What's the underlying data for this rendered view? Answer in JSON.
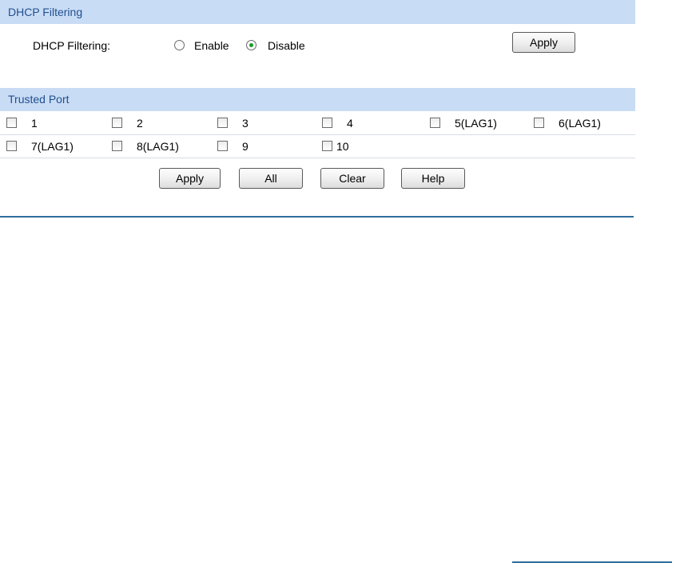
{
  "dhcp_filtering": {
    "section_title": "DHCP Filtering",
    "field_label": "DHCP Filtering:",
    "options": [
      {
        "label": "Enable",
        "selected": false
      },
      {
        "label": "Disable",
        "selected": true
      }
    ],
    "apply_label": "Apply"
  },
  "trusted_port": {
    "section_title": "Trusted Port",
    "ports": [
      {
        "label": "1",
        "checked": false
      },
      {
        "label": "2",
        "checked": false
      },
      {
        "label": "3",
        "checked": false
      },
      {
        "label": "4",
        "checked": false
      },
      {
        "label": "5(LAG1)",
        "checked": false
      },
      {
        "label": "6(LAG1)",
        "checked": false
      },
      {
        "label": "7(LAG1)",
        "checked": false
      },
      {
        "label": "8(LAG1)",
        "checked": false
      },
      {
        "label": "9",
        "checked": false
      },
      {
        "label": "10",
        "checked": false
      }
    ],
    "buttons": {
      "apply": "Apply",
      "all": "All",
      "clear": "Clear",
      "help": "Help"
    }
  },
  "colors": {
    "section_header_bg": "#c9dcf5",
    "section_header_text": "#1f4f8f",
    "divider": "#2f6e9c",
    "radio_dot": "#1a9b2a"
  }
}
